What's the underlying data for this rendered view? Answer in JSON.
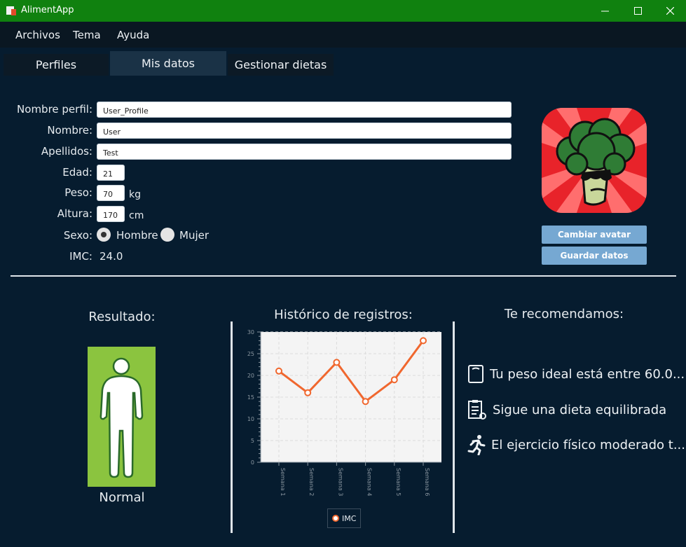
{
  "window": {
    "title": "AlimentApp"
  },
  "menu": {
    "items": [
      "Archivos",
      "Tema",
      "Ayuda"
    ]
  },
  "tabs": [
    {
      "label": "Perfiles",
      "active": false
    },
    {
      "label": "Mis datos",
      "active": true
    },
    {
      "label": "Gestionar dietas",
      "active": false
    }
  ],
  "form": {
    "profile_name": {
      "label": "Nombre perfil:",
      "value": "User_Profile"
    },
    "name": {
      "label": "Nombre:",
      "value": "User"
    },
    "surname": {
      "label": "Apellidos:",
      "value": "Test"
    },
    "age": {
      "label": "Edad:",
      "value": "21"
    },
    "weight": {
      "label": "Peso:",
      "value": "70",
      "unit": "kg"
    },
    "height": {
      "label": "Altura:",
      "value": "170",
      "unit": "cm"
    },
    "sex": {
      "label": "Sexo:",
      "options": [
        "Hombre",
        "Mujer"
      ],
      "selected": "Hombre"
    },
    "bmi": {
      "label": "IMC:",
      "value": "24.0"
    }
  },
  "avatar": {
    "change_label": "Cambiar avatar",
    "save_label": "Guardar datos"
  },
  "result": {
    "title": "Resultado:",
    "status": "Normal",
    "color": "#8bc43f"
  },
  "history": {
    "title": "Histórico de registros:"
  },
  "recommendations": {
    "title": "Te recomendamos:",
    "items": [
      {
        "icon": "scale-icon",
        "text": "Tu peso ideal está entre 60.0..."
      },
      {
        "icon": "diet-clipboard-icon",
        "text": "Sigue una dieta equilibrada"
      },
      {
        "icon": "running-person-icon",
        "text": "El ejercicio físico moderado t..."
      }
    ]
  },
  "chart_data": {
    "type": "line",
    "categories": [
      "Semana 1",
      "Semana 2",
      "Semana 3",
      "Semana 4",
      "Semana 5",
      "Semana 6"
    ],
    "series": [
      {
        "name": "IMC",
        "values": [
          21,
          16,
          23,
          14,
          19,
          28
        ],
        "color": "#f0672e"
      }
    ],
    "yticks": [
      "0",
      "5",
      "10",
      "15",
      "20",
      "25",
      "30"
    ],
    "ylim": [
      0,
      30
    ],
    "grid": true,
    "legend": "bottom"
  }
}
